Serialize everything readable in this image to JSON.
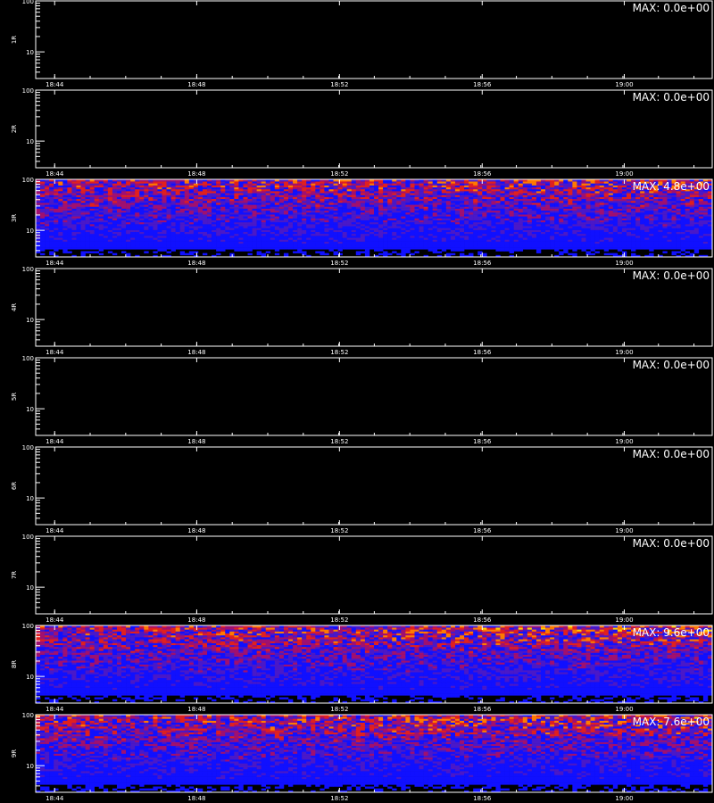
{
  "chart_data": {
    "type": "heatmap",
    "x_tick_labels": [
      "18:44",
      "18:48",
      "18:52",
      "18:56",
      "19:00"
    ],
    "y_tick_labels": [
      "10",
      "100"
    ],
    "ylim": [
      3,
      100
    ],
    "y_scale": "log",
    "colormap": [
      "#000000",
      "#1010ff",
      "#4a18c8",
      "#a01070",
      "#e02020",
      "#ff7a00",
      "#ffd000"
    ],
    "panels": [
      {
        "ylabel": "1R",
        "max_label": "MAX: 0.0e+00",
        "max": 0.0,
        "has_data": false
      },
      {
        "ylabel": "2R",
        "max_label": "MAX: 0.0e+00",
        "max": 0.0,
        "has_data": false
      },
      {
        "ylabel": "3R",
        "max_label": "MAX: 4.8e+00",
        "max": 4.8,
        "has_data": true
      },
      {
        "ylabel": "4R",
        "max_label": "MAX: 0.0e+00",
        "max": 0.0,
        "has_data": false
      },
      {
        "ylabel": "5R",
        "max_label": "MAX: 0.0e+00",
        "max": 0.0,
        "has_data": false
      },
      {
        "ylabel": "6R",
        "max_label": "MAX: 0.0e+00",
        "max": 0.0,
        "has_data": false
      },
      {
        "ylabel": "7R",
        "max_label": "MAX: 0.0e+00",
        "max": 0.0,
        "has_data": false
      },
      {
        "ylabel": "8R",
        "max_label": "MAX: 9.6e+00",
        "max": 9.6,
        "has_data": true
      },
      {
        "ylabel": "9R",
        "max_label": "MAX: 7.6e+00",
        "max": 7.6,
        "has_data": true
      }
    ]
  },
  "footer": {
    "text": ""
  }
}
